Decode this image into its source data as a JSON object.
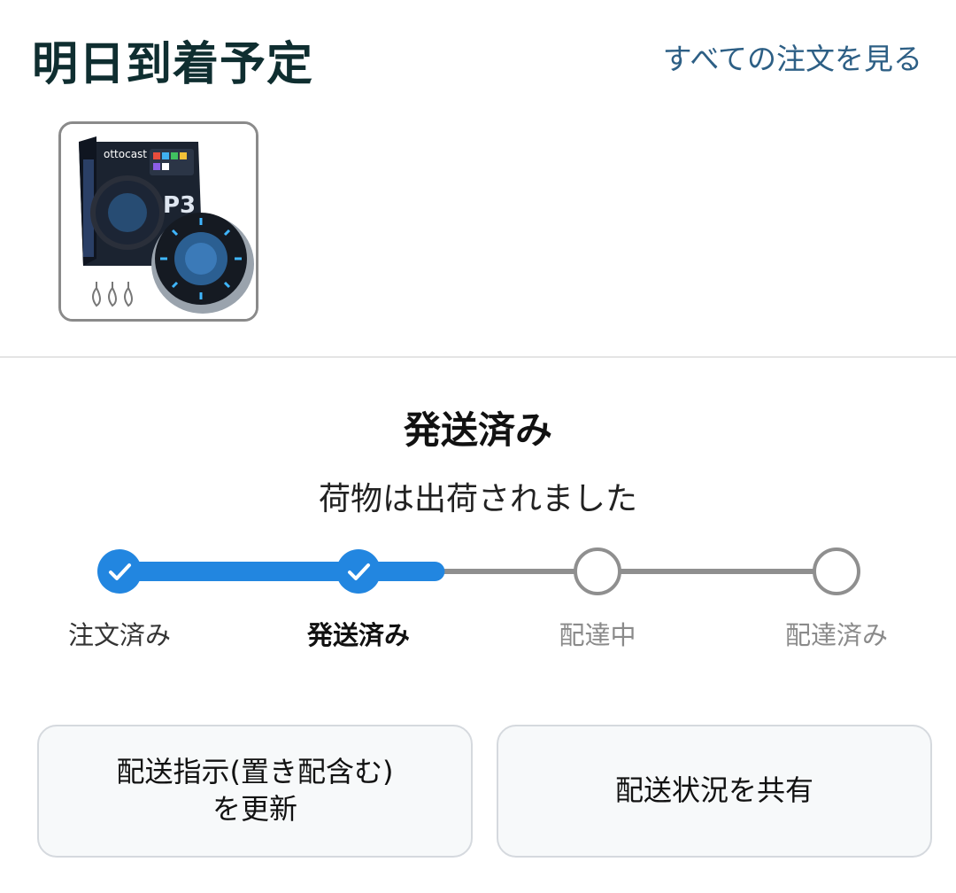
{
  "header": {
    "title": "明日到着予定",
    "view_all_link": "すべての注文を見る"
  },
  "product": {
    "image_alt": "otocast P3 CarPlay adapter"
  },
  "status": {
    "title": "発送済み",
    "subtitle": "荷物は出荷されました",
    "progress_fraction": 0.44,
    "steps": [
      {
        "label": "注文済み",
        "state": "done"
      },
      {
        "label": "発送済み",
        "state": "current"
      },
      {
        "label": "配達中",
        "state": "pending"
      },
      {
        "label": "配達済み",
        "state": "pending"
      }
    ]
  },
  "actions": {
    "delivery_instructions_label": "配送指示(置き配含む)\nを更新",
    "share_status_label": "配送状況を共有"
  },
  "colors": {
    "accent": "#2286e0",
    "inactive": "#8f8f8f",
    "link": "#2d5f85",
    "title": "#0f2e30"
  }
}
